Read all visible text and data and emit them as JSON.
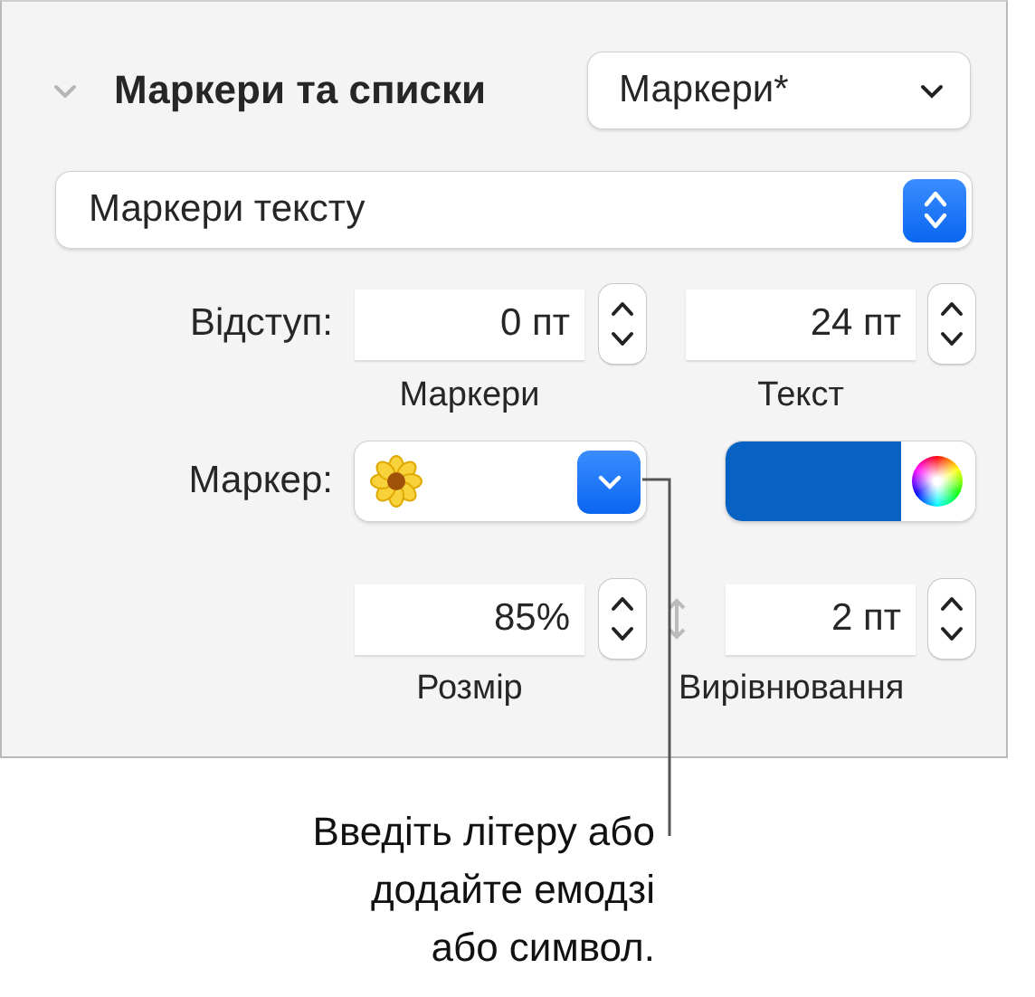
{
  "section": {
    "title": "Маркери та списки",
    "expanded": true,
    "style_popup": "Маркери*"
  },
  "list_type": "Маркери тексту",
  "indent": {
    "label": "Відступ:",
    "fields": [
      {
        "value": "0 пт",
        "caption": "Маркери"
      },
      {
        "value": "24 пт",
        "caption": "Текст"
      }
    ]
  },
  "bullet": {
    "label": "Маркер:",
    "color": "#0862c3"
  },
  "size": {
    "value": "85%",
    "caption": "Розмір"
  },
  "align": {
    "value": "2 пт",
    "caption": "Вирівнювання"
  },
  "callout": "Введіть літеру або\nдодайте емодзі\nабо символ."
}
